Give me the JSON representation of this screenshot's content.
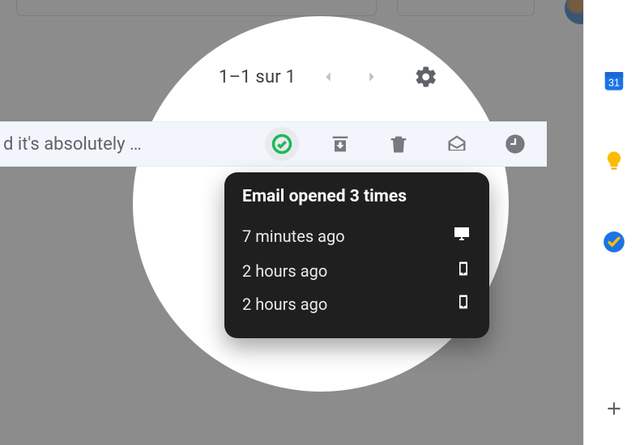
{
  "pager": {
    "count_text": "1–1 sur 1"
  },
  "row": {
    "snippet": "d it's absolutely …"
  },
  "tooltip": {
    "title": "Email opened 3 times",
    "events": [
      {
        "time": "7 minutes ago",
        "device": "desktop"
      },
      {
        "time": "2 hours ago",
        "device": "mobile"
      },
      {
        "time": "2 hours ago",
        "device": "mobile"
      }
    ]
  },
  "sidepanel": {
    "calendar_day": "31"
  }
}
